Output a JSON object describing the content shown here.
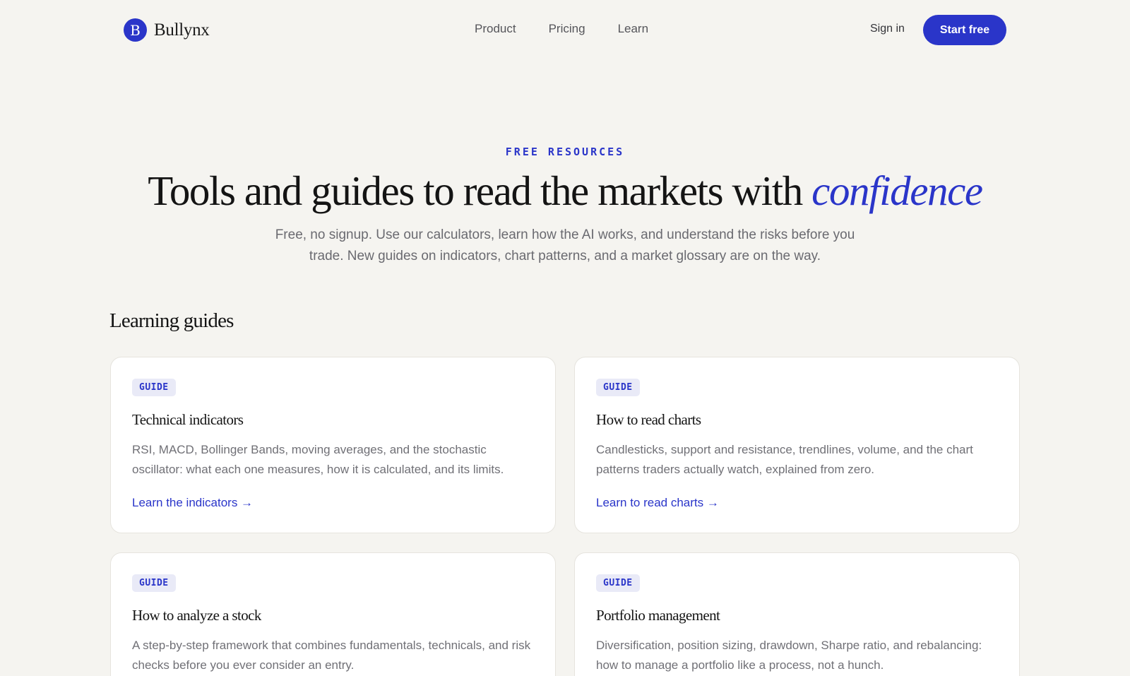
{
  "header": {
    "logo_letter": "B",
    "brand": "Bullynx",
    "nav": [
      {
        "label": "Product"
      },
      {
        "label": "Pricing"
      },
      {
        "label": "Learn"
      }
    ],
    "signin_label": "Sign in",
    "cta_label": "Start free"
  },
  "hero": {
    "eyebrow": "FREE RESOURCES",
    "title_main": "Tools and guides to read the markets with ",
    "title_accent": "confidence",
    "subtitle": "Free, no signup. Use our calculators, learn how the AI works, and understand the risks before you trade. New guides on indicators, chart patterns, and a market glossary are on the way."
  },
  "learning": {
    "section_title": "Learning guides",
    "cards": [
      {
        "badge": "GUIDE",
        "title": "Technical indicators",
        "description": "RSI, MACD, Bollinger Bands, moving averages, and the stochastic oscillator: what each one measures, how it is calculated, and its limits.",
        "link": "Learn the indicators →"
      },
      {
        "badge": "GUIDE",
        "title": "How to read charts",
        "description": "Candlesticks, support and resistance, trendlines, volume, and the chart patterns traders actually watch, explained from zero.",
        "link": "Learn to read charts →"
      },
      {
        "badge": "GUIDE",
        "title": "How to analyze a stock",
        "description": "A step-by-step framework that combines fundamentals, technicals, and risk checks before you ever consider an entry."
      },
      {
        "badge": "GUIDE",
        "title": "Portfolio management",
        "description": "Diversification, position sizing, drawdown, Sharpe ratio, and rebalancing: how to manage a portfolio like a process, not a hunch."
      }
    ]
  },
  "colors": {
    "accent": "#2a35c9",
    "background": "#f5f4f0",
    "card": "#ffffff",
    "badge_bg": "#e9eaf7"
  }
}
